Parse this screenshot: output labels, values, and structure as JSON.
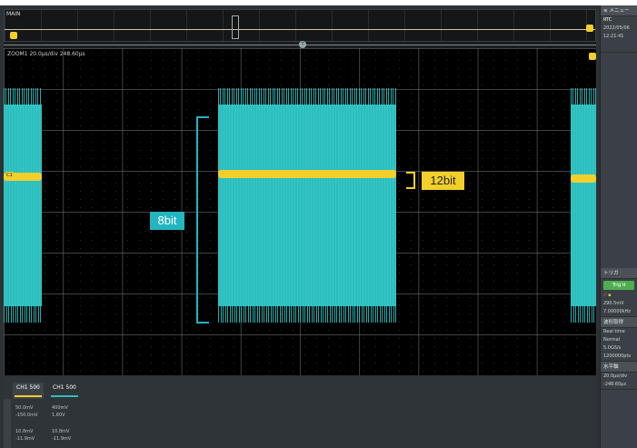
{
  "annotations": {
    "label_8bit": "8bit",
    "label_12bit": "12bit"
  },
  "overview": {
    "label": "MAIN"
  },
  "main": {
    "zoom_label": "ZOOM1  20.0μs/div  248.60μs",
    "ch_marker_label": "C1"
  },
  "sidebar": {
    "menu_label": "≡ メニュー",
    "rtc_label": "RTC",
    "date": "2022/05/06",
    "time": "12:21:41",
    "trigger_title": "トリガ",
    "trigger_mode": "Trig'd",
    "trigger_level": "290.5mV",
    "trigger_freq": "7.00000kHz",
    "acq_title": "波形取得",
    "acq_mode": "Real time",
    "acq_type": "Normal",
    "acq_rate": "5.0GS/s",
    "acq_points": "1200000pts",
    "horiz_title": "水平軸",
    "horiz_scale": "20.0μs/div",
    "horiz_pos": "-248.60μs"
  },
  "bottom": {
    "ch1_label": "CH1 500",
    "ch2_label": "CH1 500",
    "ch1_val1": "50.0mV",
    "ch1_val2": "-150.0mV",
    "ch2_val1": "400mV",
    "ch2_val2": "1.60V",
    "ch1_val3": "10.8mV",
    "ch1_val4": "-11.9mV",
    "ch2_val3": "10.8mV",
    "ch2_val4": "-11.9mV"
  },
  "colors": {
    "cyan": "#2bbfbf",
    "yellow": "#f2cf2a",
    "trig_green": "#4fae4f"
  }
}
